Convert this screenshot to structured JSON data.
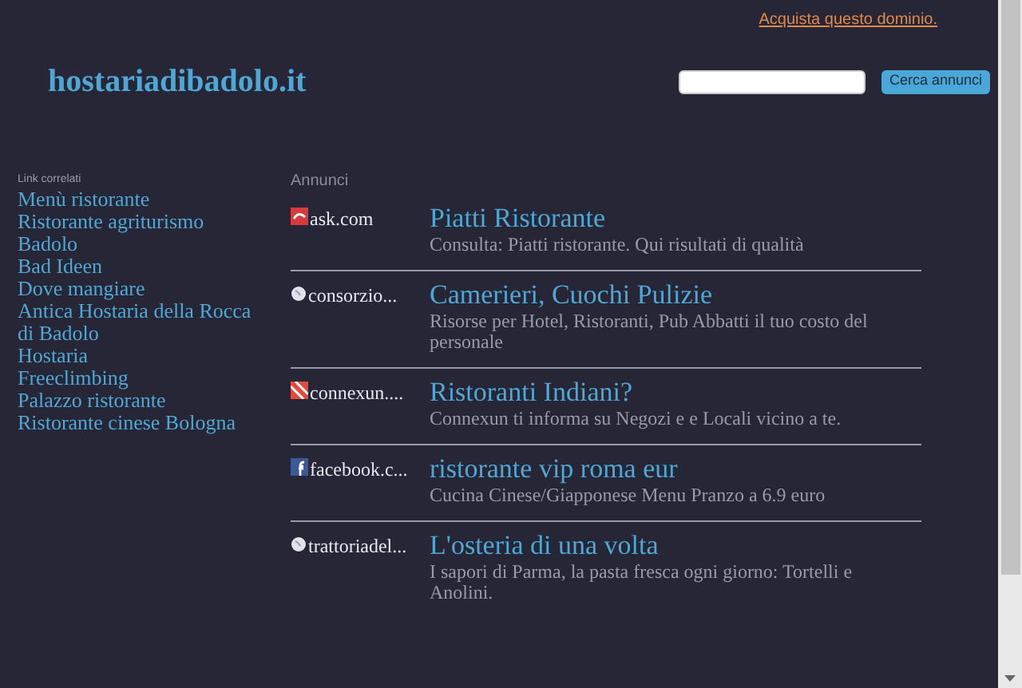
{
  "top_link": "Acquista questo dominio.",
  "logo": "hostariadibadolo.it",
  "search": {
    "button": "Cerca annunci"
  },
  "sidebar": {
    "heading": "Link correlati",
    "items": [
      "Menù ristorante",
      "Ristorante agriturismo",
      "Badolo",
      "Bad Ideen",
      "Dove mangiare",
      "Antica Hostaria della Rocca di Badolo",
      "Hostaria",
      "Freeclimbing",
      "Palazzo ristorante",
      "Ristorante cinese Bologna"
    ]
  },
  "ads": {
    "heading": "Annunci",
    "items": [
      {
        "kind": "red-square",
        "source": "ask.com",
        "title": "Piatti Ristorante",
        "description": "Consulta: Piatti ristorante. Qui risultati di qualità"
      },
      {
        "kind": "globe",
        "source": "consorzio...",
        "title": "Camerieri, Cuochi Pulizie",
        "description": "Risorse per Hotel, Ristoranti, Pub Abbatti il tuo costo del personale"
      },
      {
        "kind": "striped",
        "source": "connexun....",
        "title": "Ristoranti Indiani?",
        "description": "Connexun ti informa su Negozi e e Locali vicino a te."
      },
      {
        "kind": "f-square",
        "source": "facebook.c...",
        "title": "ristorante vip roma eur",
        "description": "Cucina Cinese/Giapponese Menu Pranzo a 6.9 euro"
      },
      {
        "kind": "globe",
        "source": "trattoriadel...",
        "title": "L'osteria di una volta",
        "description": "I sapori di Parma, la pasta fresca ogni giorno: Tortelli e Anolini."
      }
    ]
  }
}
